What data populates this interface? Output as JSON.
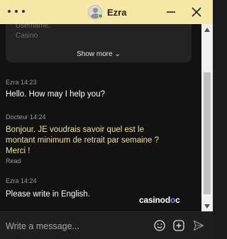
{
  "header": {
    "agent_name": "Ezra"
  },
  "info_card": {
    "line1": "Username:",
    "line2": "Casino",
    "show_more": "Show more ⌄"
  },
  "messages": [
    {
      "meta": "Ezra 14:23",
      "text": "Hello. How may I help you?"
    },
    {
      "meta": "Docteur 14:24",
      "text": "Bonjour. JE voudrais savoir quel est le montant minimum de retrait par semaine ? Merci !",
      "status": "Read"
    },
    {
      "meta": "Ezra 14:24",
      "text": "Please write in English."
    }
  ],
  "logo": {
    "part1": "casino",
    "part2": "d",
    "part3": "o",
    "part4": "c"
  },
  "composer": {
    "placeholder": "Write a message..."
  },
  "colors": {
    "header_bg": "#f7e7a6",
    "agent_text": "#f0e294",
    "online_status": "#47b04b"
  }
}
